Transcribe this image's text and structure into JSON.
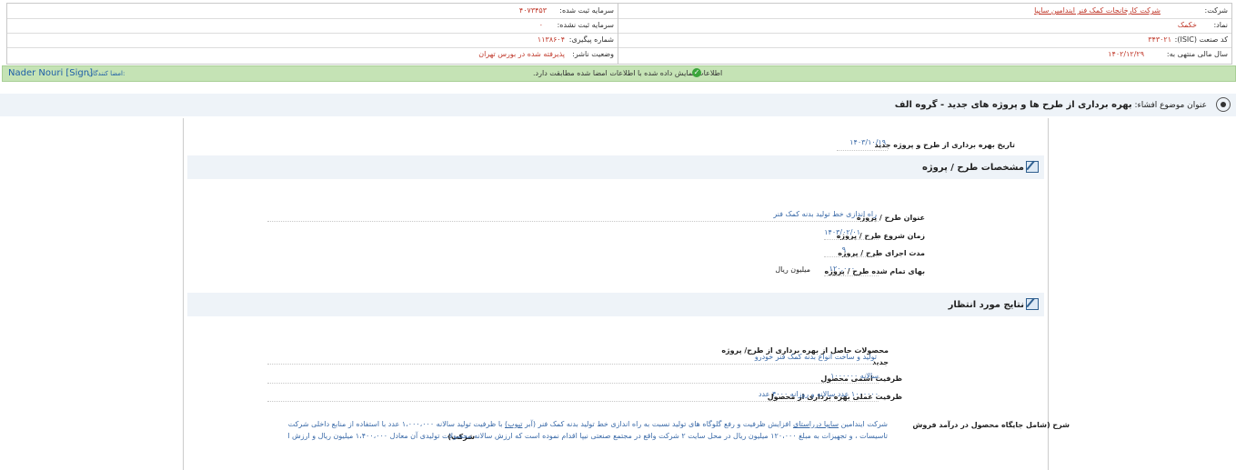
{
  "info": {
    "company_label": "شرکت:",
    "company_value": "شرکت کارخانجات کمک فنر ایندامین سایپا",
    "symbol_label": "نماد:",
    "symbol_value": "خکمک",
    "isic_label": "کد صنعت (ISIC):",
    "isic_value": "۳۴۳۰۲۱",
    "fiscal_label": "سال مالی منتهی به:",
    "fiscal_value": "۱۴۰۲/۱۲/۲۹",
    "registered_capital_label": "سرمایه ثبت شده:",
    "registered_capital_value": "۴۰۷۳۴۵۳",
    "unregistered_capital_label": "سرمایه ثبت نشده:",
    "unregistered_capital_value": "۰",
    "tracking_label": "شماره پیگیری:",
    "tracking_value": "۱۱۳۸۶۰۴",
    "publisher_status_label": "وضعیت ناشر:",
    "publisher_status_value": "پذیرفته شده در بورس تهران"
  },
  "signature": {
    "label": "امضا کنندگان:",
    "name": "Nader Nouri [Sign]",
    "message": "اطلاعات نمایش داده شده با اطلاعات امضا شده مطابقت دارد."
  },
  "subject": {
    "label": "عنوان موضوع افشاء:",
    "value": "بهره برداری از طرح ها و پروژه های جدید - گروه الف"
  },
  "main": {
    "operation_date_label": "تاریخ بهره برداری از طرح و پروژه جدید",
    "operation_date_value": "۱۴۰۳/۱۰/۱۹",
    "section1_title": "مشخصات طرح / پروژه",
    "project_title_label": "عنوان طرح / پروژه",
    "project_title_value": "راه اندازی خط تولید بدنه کمک فنر",
    "start_label": "زمان شروع طرح / پروژه",
    "start_value": "۱۴۰۳/۰۲/۰۱",
    "duration_label": "مدت اجرای طرح / پروژه",
    "duration_value": "۹",
    "cost_label": "بهای تمام شده طرح / پروژه",
    "cost_value": "۱۲۰,۰۰۰",
    "cost_unit": "میلیون ریال",
    "section2_title": "نتایج مورد انتظار",
    "products_label": "محصولات حاصل از بهره برداری از طرح/ پروژه",
    "products_label2": "جدید",
    "products_value": "تولید و ساخت انواع بدنه کمک فنر خودرو",
    "nominal_label": "ظرفیت اسمی محصول",
    "nominal_value": "سالانه ۱۰۰۰۰۰۰",
    "practical_label": "ظرفیت عملی بهره برداری از محصول",
    "practical_value": "۱۰۰۰۰۰۰ عدد سالانه و روزانه ۴۰۰۰ عدد",
    "note_label": "شرح (شامل جایگاه محصول در درآمد فروش",
    "note_label2": "شرکت)",
    "note_line1_a": "شرکت ایندامین",
    "note_line1_link": "سایپا درراستای",
    "note_line1_b": "افزایش ظرفیت و رفع گلوگاه های تولید نسبت به راه اندازی خط تولید بدنه کمک فنر (آبر",
    "note_line1_link2": "تیوب)",
    "note_line1_c": "با ظرفیت تولید سالانه ۱،۰۰۰،۰۰۰ عدد با استفاده از منابع داخلی شرکت و پرداخت مخارج سرمایه ای، شامل ماشین آلات ،",
    "note_line2": "تاسیسات ، و تجهیزات به مبلغ ۱۲۰،۰۰۰ میلیون ریال در محل سایت ۲ شرکت واقع در مجتمع صنعتی نیپا اقدام نموده است که ارزش سالانه محصولات تولیدی آن معادل ۱،۴۰۰،۰۰۰ میلیون ریال و ارزش افزوده آن ۲۰۰،۰۰۰میلیون ریال می باشد ."
  }
}
